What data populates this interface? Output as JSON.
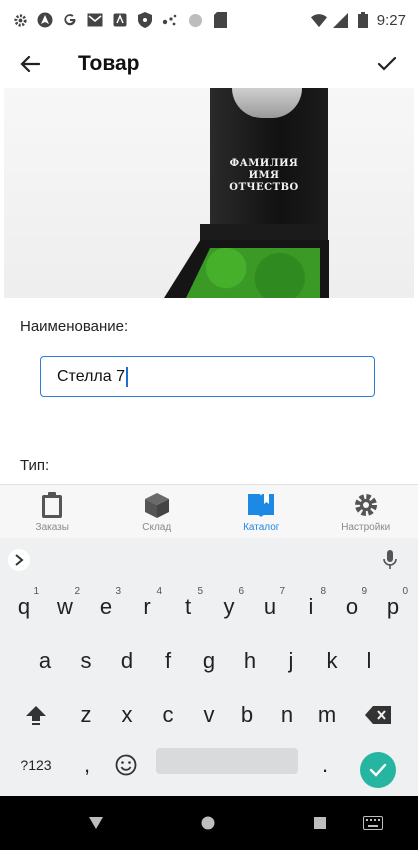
{
  "status_bar": {
    "time": "9:27",
    "left_icons": [
      "settings-icon",
      "navigation-icon",
      "google-icon",
      "gmail-icon",
      "app-icon",
      "shield-icon",
      "dots-icon",
      "circle-icon",
      "sd-card-icon"
    ],
    "right_icons": [
      "wifi-icon",
      "signal-icon",
      "battery-icon"
    ]
  },
  "app_bar": {
    "title": "Товар",
    "back_icon": "arrow-left-icon",
    "save_icon": "check-icon"
  },
  "product_image": {
    "stone_text": [
      "ФАМИЛИЯ",
      "ИМЯ",
      "ОТЧЕСТВО"
    ]
  },
  "form": {
    "name_label": "Наименование:",
    "name_value": "Стелла 7",
    "type_label": "Тип:"
  },
  "bottom_nav": {
    "items": [
      {
        "label": "Заказы",
        "icon": "clipboard-icon",
        "active": false
      },
      {
        "label": "Склад",
        "icon": "box-icon",
        "active": false
      },
      {
        "label": "Каталог",
        "icon": "book-icon",
        "active": true
      },
      {
        "label": "Настройки",
        "icon": "gear-icon",
        "active": false
      }
    ],
    "active_color": "#1e88e5",
    "inactive_color": "#555555"
  },
  "keyboard": {
    "row1": [
      {
        "key": "q",
        "hint": "1"
      },
      {
        "key": "w",
        "hint": "2"
      },
      {
        "key": "e",
        "hint": "3"
      },
      {
        "key": "r",
        "hint": "4"
      },
      {
        "key": "t",
        "hint": "5"
      },
      {
        "key": "y",
        "hint": "6"
      },
      {
        "key": "u",
        "hint": "7"
      },
      {
        "key": "i",
        "hint": "8"
      },
      {
        "key": "o",
        "hint": "9"
      },
      {
        "key": "p",
        "hint": "0"
      }
    ],
    "row2": [
      "a",
      "s",
      "d",
      "f",
      "g",
      "h",
      "j",
      "k",
      "l"
    ],
    "row3": [
      "z",
      "x",
      "c",
      "v",
      "b",
      "n",
      "m"
    ],
    "symbols_label": "?123",
    "comma": ",",
    "period": ".",
    "enter_color": "#26b5a1"
  }
}
